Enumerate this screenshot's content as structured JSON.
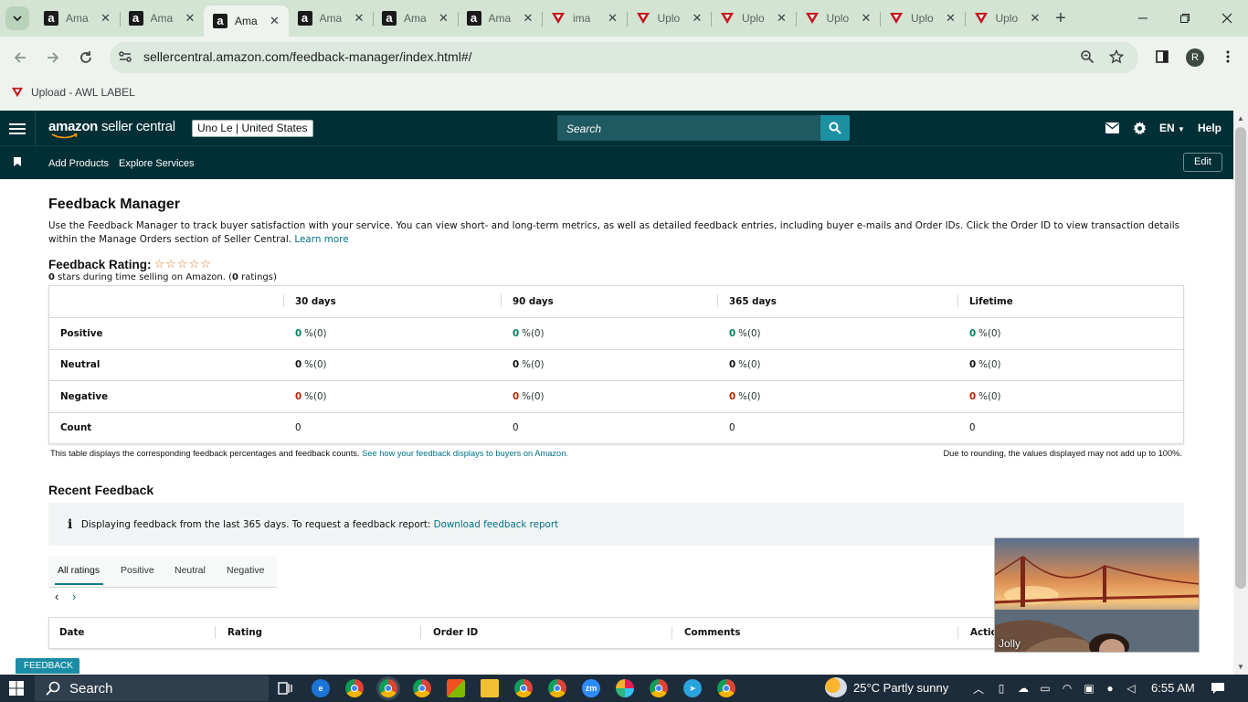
{
  "browser": {
    "tabs": [
      {
        "icon": "amazon-icon",
        "title": "Amazon"
      },
      {
        "icon": "amazon-icon",
        "title": "Amazon"
      },
      {
        "icon": "amazon-icon",
        "title": "Amazon",
        "active": true
      },
      {
        "icon": "amazon-icon",
        "title": "Amazon"
      },
      {
        "icon": "amazon-icon",
        "title": "Amazon"
      },
      {
        "icon": "amazon-icon",
        "title": "Amazon"
      },
      {
        "icon": "awl-icon",
        "title": "image"
      },
      {
        "icon": "awl-icon",
        "title": "Upload"
      },
      {
        "icon": "awl-icon",
        "title": "Upload"
      },
      {
        "icon": "awl-icon",
        "title": "Upload"
      },
      {
        "icon": "awl-icon",
        "title": "Upload"
      },
      {
        "icon": "awl-icon",
        "title": "Upload"
      }
    ],
    "tab_short": [
      "Ama",
      "Ama",
      "Ama",
      "Ama",
      "Ama",
      "Ama",
      "ima",
      "Uplo",
      "Uplo",
      "Uplo",
      "Uplo",
      "Uplo"
    ],
    "url": "sellercentral.amazon.com/feedback-manager/index.html#/",
    "profile_initial": "R",
    "bookmark": "Upload - AWL LABEL"
  },
  "header": {
    "logo_prefix": "amazon",
    "logo_suffix": "seller central",
    "store": "Uno Le | United States",
    "search_placeholder": "Search",
    "language": "EN",
    "help": "Help"
  },
  "subnav": {
    "items": [
      "Add Products",
      "Explore Services"
    ],
    "edit": "Edit"
  },
  "page": {
    "title": "Feedback Manager",
    "intro": "Use the Feedback Manager to track buyer satisfaction with your service. You can view short- and long-term metrics, as well as detailed feedback entries, including buyer e-mails and Order IDs. Click the Order ID to view transaction details within the Manage Orders section of Seller Central.",
    "learn_more": "Learn more",
    "rating_label": "Feedback Rating:",
    "stars_glyphs": "☆☆☆☆☆",
    "stars_count": "0",
    "stars_text": " stars during time selling on Amazon. (",
    "ratings_count": "0",
    "ratings_text": " ratings)"
  },
  "feedback_table": {
    "columns": [
      "30 days",
      "90 days",
      "365 days",
      "Lifetime"
    ],
    "rows": [
      {
        "label": "Positive",
        "values": [
          "0",
          "0",
          "0",
          "0"
        ],
        "suffix": "%(0)",
        "kind": "pos"
      },
      {
        "label": "Neutral",
        "values": [
          "0",
          "0",
          "0",
          "0"
        ],
        "suffix": "%(0)",
        "kind": "neu"
      },
      {
        "label": "Negative",
        "values": [
          "0",
          "0",
          "0",
          "0"
        ],
        "suffix": "%(0)",
        "kind": "neg"
      },
      {
        "label": "Count",
        "values": [
          "0",
          "0",
          "0",
          "0"
        ],
        "suffix": "",
        "kind": "count"
      }
    ],
    "note": "This table displays the corresponding feedback percentages and feedback counts.",
    "note_link": "See how your feedback displays to buyers on Amazon.",
    "rounding_note": "Due to rounding, the values displayed may not add up to 100%."
  },
  "recent": {
    "title": "Recent Feedback",
    "info_icon": "i",
    "info_text": "Displaying feedback from the last 365 days. To request a feedback report:",
    "info_link": "Download feedback report",
    "tabs": [
      "All ratings",
      "Positive",
      "Neutral",
      "Negative"
    ],
    "prev": "‹",
    "next": "›",
    "columns": [
      "Date",
      "Rating",
      "Order ID",
      "Comments",
      "Actio"
    ]
  },
  "feedback_widget": "FEEDBACK ×",
  "video_call": {
    "participant": "Jolly"
  },
  "taskbar": {
    "search": "Search",
    "weather": "25°C  Partly sunny",
    "time": "6:55 AM"
  },
  "colors": {
    "header_bg": "#002f36",
    "link": "#007185",
    "positive": "#067d62",
    "negative": "#b12704",
    "search_button": "#1d8fa3"
  }
}
